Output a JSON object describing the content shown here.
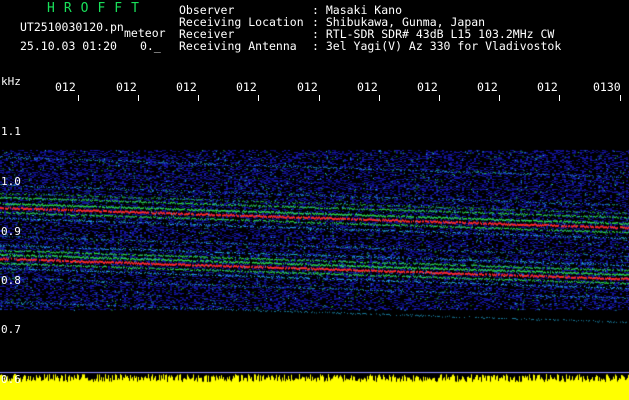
{
  "header": {
    "brand": "HROFFT",
    "filename": "UT2510030120.pn",
    "mode": "meteor",
    "datetime": "25.10.03 01:20",
    "counter": "0._",
    "observer_label": "Observer",
    "observer_value": ": Masaki Kano",
    "location_label": "Receiving Location",
    "location_value": ": Shibukawa, Gunma, Japan",
    "receiver_label": "Receiver",
    "receiver_value": ": RTL-SDR SDR# 43dB L15 103.2MHz CW",
    "antenna_label": "Receiving Antenna",
    "antenna_value": ": 3el Yagi(V) Az 330 for Vladivostok"
  },
  "axis": {
    "y_unit": "kHz",
    "y_ticks": [
      "1.1",
      "1.0",
      "0.9",
      "0.8",
      "0.7",
      "0.6"
    ],
    "x_ticks": [
      "012",
      "012",
      "012",
      "012",
      "012",
      "012",
      "012",
      "012",
      "012",
      "0130"
    ]
  },
  "colors": {
    "brand": "#19e05a",
    "text": "#ffffff",
    "background": "#000000",
    "noise_floor": "#1616a0",
    "signal_strong": "#ff2a2a",
    "signal_mid": "#28d848",
    "signal_weak": "#28c8ff",
    "level_bar": "#ffff00"
  }
}
